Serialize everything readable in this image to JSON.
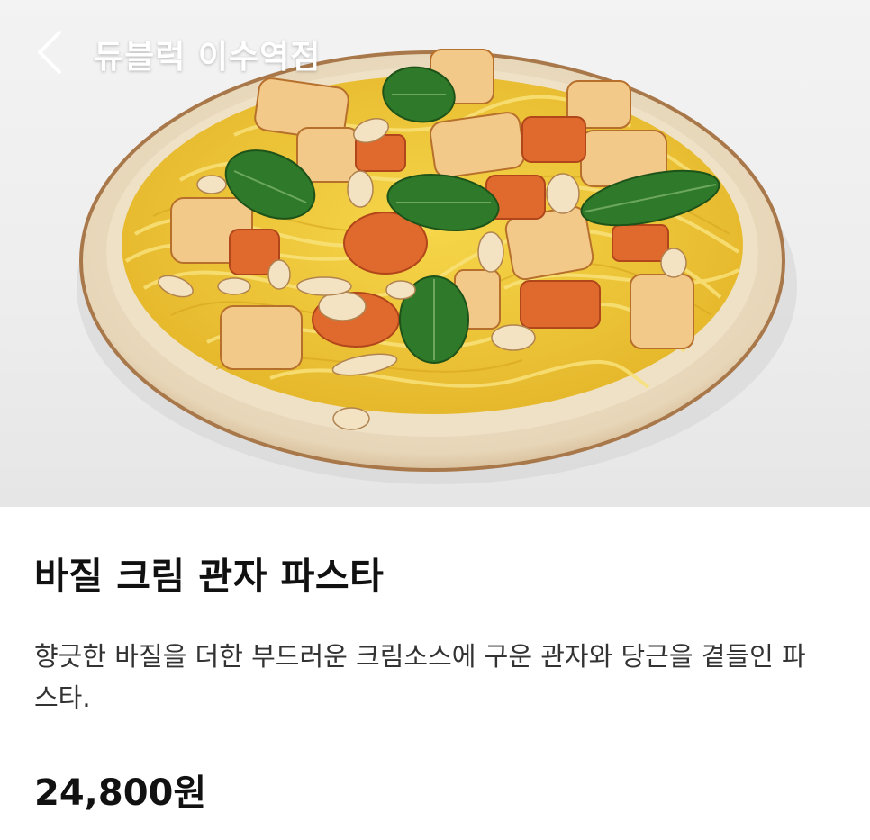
{
  "header": {
    "store_name": "듀블럭 이수역점",
    "back_icon": "chevron-left-icon"
  },
  "hero": {
    "image_subject": "basil-cream-scallop-pasta-photo"
  },
  "menu": {
    "title": "바질 크림 관자 파스타",
    "description": "향긋한 바질을 더한 부드러운 크림소스에 구운 관자와 당근을 곁들인 파스타.",
    "price": "24,800원"
  },
  "colors": {
    "text_primary": "#111111",
    "text_secondary": "#333333",
    "header_text": "#ffffff"
  }
}
